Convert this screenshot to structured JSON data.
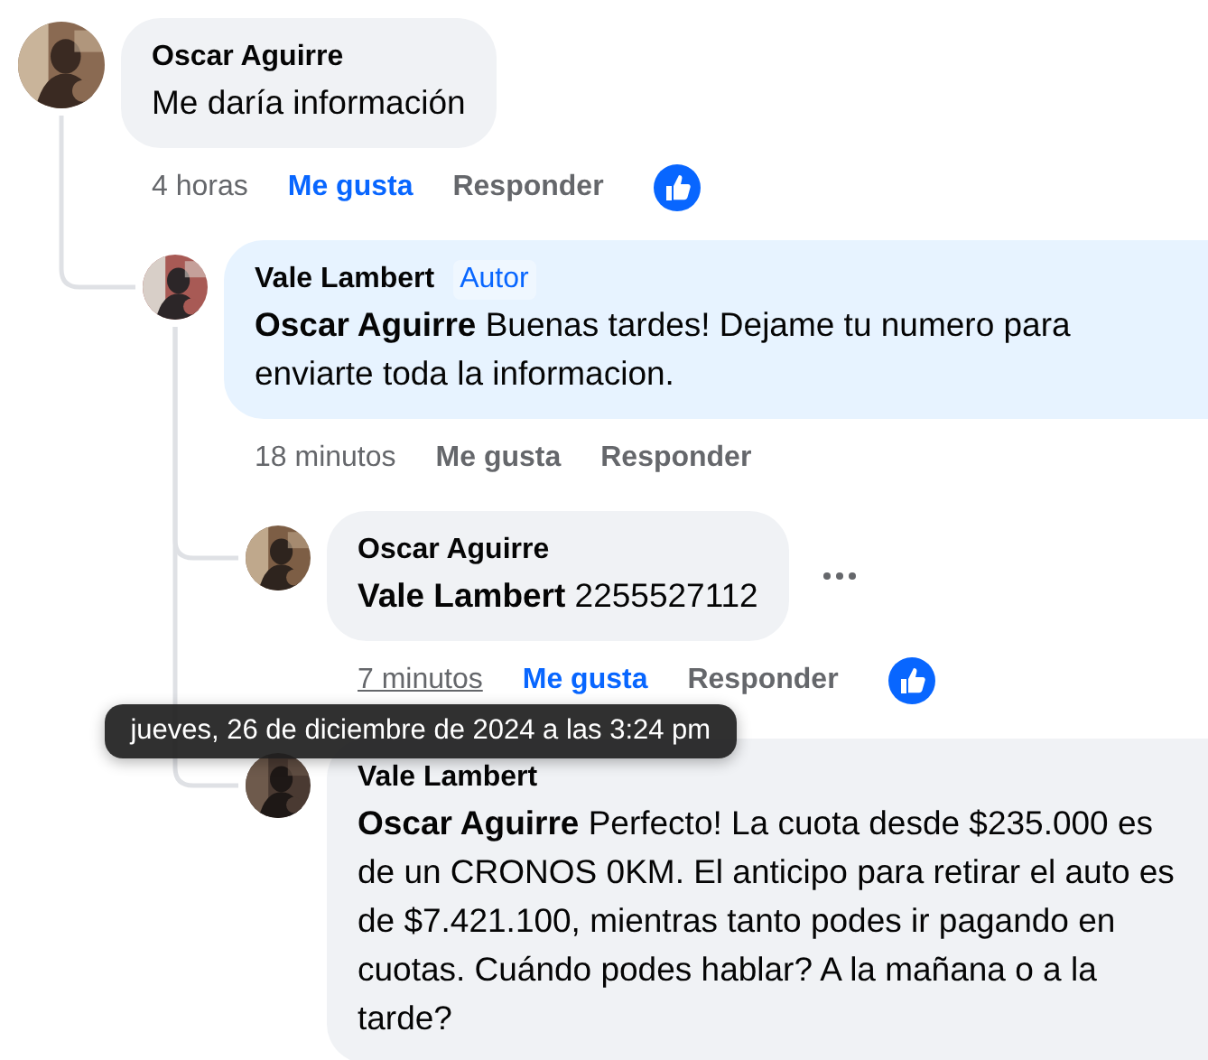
{
  "comments": [
    {
      "author": "Oscar Aguirre",
      "text": "Me daría información",
      "avatar": {
        "kind": "picture"
      },
      "time": "4 horas",
      "time_hovered": false,
      "like_label": "Me gusta",
      "liked": true,
      "reply_label": "Responder",
      "reacted": true,
      "replies": [
        {
          "author": "Vale Lambert",
          "badge": "Autor",
          "text": "**Oscar Aguirre** Buenas tardes! Dejame tu numero para enviarte toda la informacion.",
          "avatar": {
            "kind": "picture"
          },
          "time": "18 minutos",
          "time_hovered": false,
          "like_label": "Me gusta",
          "liked": false,
          "reply_label": "Responder",
          "reacted": false,
          "replies": [
            {
              "author": "Oscar Aguirre",
              "text": "**Vale Lambert** 2255527112",
              "avatar": {
                "kind": "picture"
              },
              "time": "7 minutos",
              "time_hovered": true,
              "like_label": "Me gusta",
              "liked": true,
              "reply_label": "Responder",
              "reacted": true,
              "more_menu": true
            },
            {
              "author": "Vale Lambert",
              "text": "**Oscar Aguirre** Perfecto! La cuota desde $235.000 es de un CRONOS 0KM. El anticipo para retirar el auto es de $7.421.100, mientras tanto podes ir pagando en cuotas. Cuándo podes hablar? A la mañana o a la tarde?",
              "avatar": {
                "kind": "picture"
              }
            }
          ]
        }
      ]
    }
  ],
  "tooltip": {
    "text": "jueves, 26 de diciembre de 2024 a las 3:24 pm"
  }
}
